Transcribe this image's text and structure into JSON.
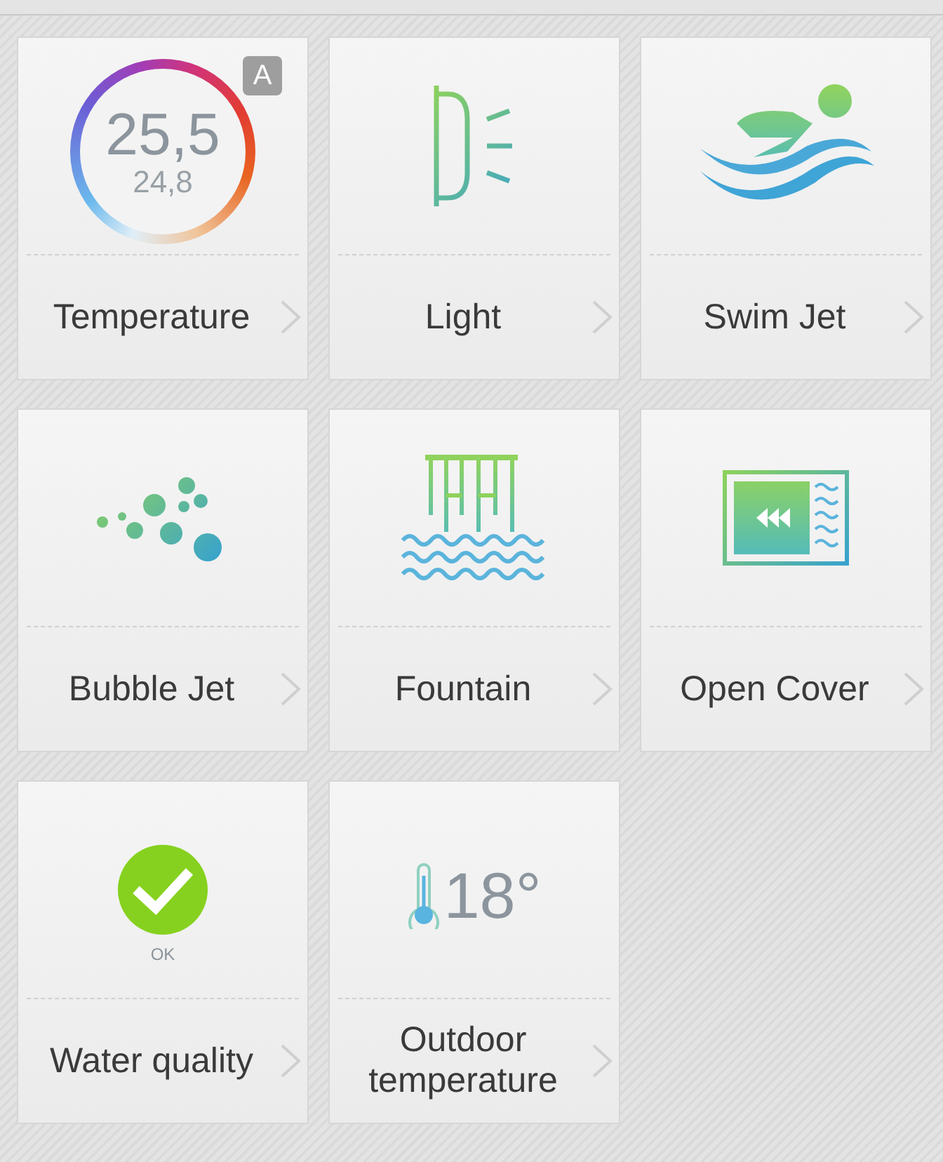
{
  "tiles": [
    {
      "kind": "temperature",
      "label": "Temperature",
      "value": "25,5",
      "secondary": "24,8",
      "badge": "A"
    },
    {
      "kind": "light",
      "label": "Light"
    },
    {
      "kind": "swim",
      "label": "Swim Jet"
    },
    {
      "kind": "bubbles",
      "label": "Bubble Jet"
    },
    {
      "kind": "fountain",
      "label": "Fountain"
    },
    {
      "kind": "cover",
      "label": "Open Cover"
    },
    {
      "kind": "water_quality",
      "label": "Water quality",
      "status": "OK"
    },
    {
      "kind": "outdoor",
      "label": "Outdoor temperature",
      "value": "18°"
    }
  ]
}
